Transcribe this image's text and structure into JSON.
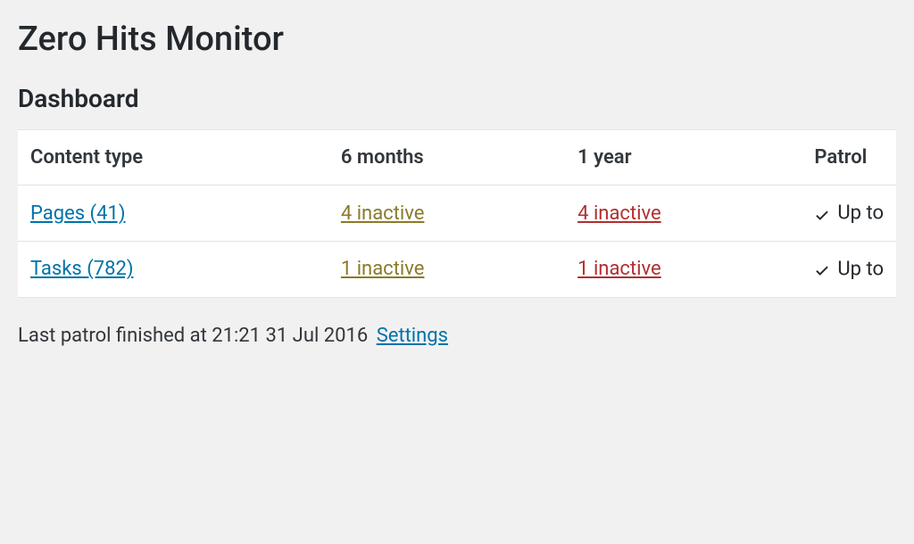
{
  "page": {
    "title": "Zero Hits Monitor",
    "section": "Dashboard"
  },
  "table": {
    "headers": {
      "content_type": "Content type",
      "six_months": "6 months",
      "one_year": "1 year",
      "patrol": "Patrol"
    },
    "rows": [
      {
        "content_type": "Pages (41)",
        "six_months": "4 inactive",
        "one_year": "4 inactive",
        "patrol": "Up to"
      },
      {
        "content_type": "Tasks (782)",
        "six_months": "1 inactive",
        "one_year": "1 inactive",
        "patrol": "Up to"
      }
    ]
  },
  "footer": {
    "text": "Last patrol finished at 21:21 31 Jul 2016",
    "settings_link": "Settings"
  }
}
